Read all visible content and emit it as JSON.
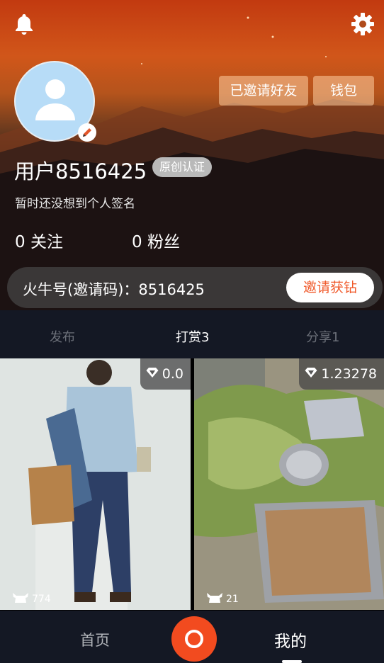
{
  "header": {
    "invited_friends_label": "已邀请好友",
    "wallet_label": "钱包",
    "icons": [
      "bell-icon",
      "gear-icon",
      "edit-icon"
    ]
  },
  "profile": {
    "username": "用户8516425",
    "badge": "原创认证",
    "signature": "暂时还没想到个人签名",
    "following": "0 关注",
    "fans": "0 粉丝"
  },
  "invite": {
    "code_text": "火牛号(邀请码)：8516425",
    "button_label": "邀请获钻"
  },
  "tabs": [
    {
      "label": "发布",
      "active": false
    },
    {
      "label": "打赏3",
      "active": true
    },
    {
      "label": "分享1",
      "active": false
    }
  ],
  "posts": [
    {
      "price": "0.0",
      "likes": "774"
    },
    {
      "price": "1.23278",
      "likes": "21"
    }
  ],
  "nav": {
    "home": "首页",
    "mine": "我的"
  },
  "colors": {
    "accent": "#f24b1f",
    "invite_button_text": "#f05a2b",
    "nav_bg": "#141824"
  }
}
